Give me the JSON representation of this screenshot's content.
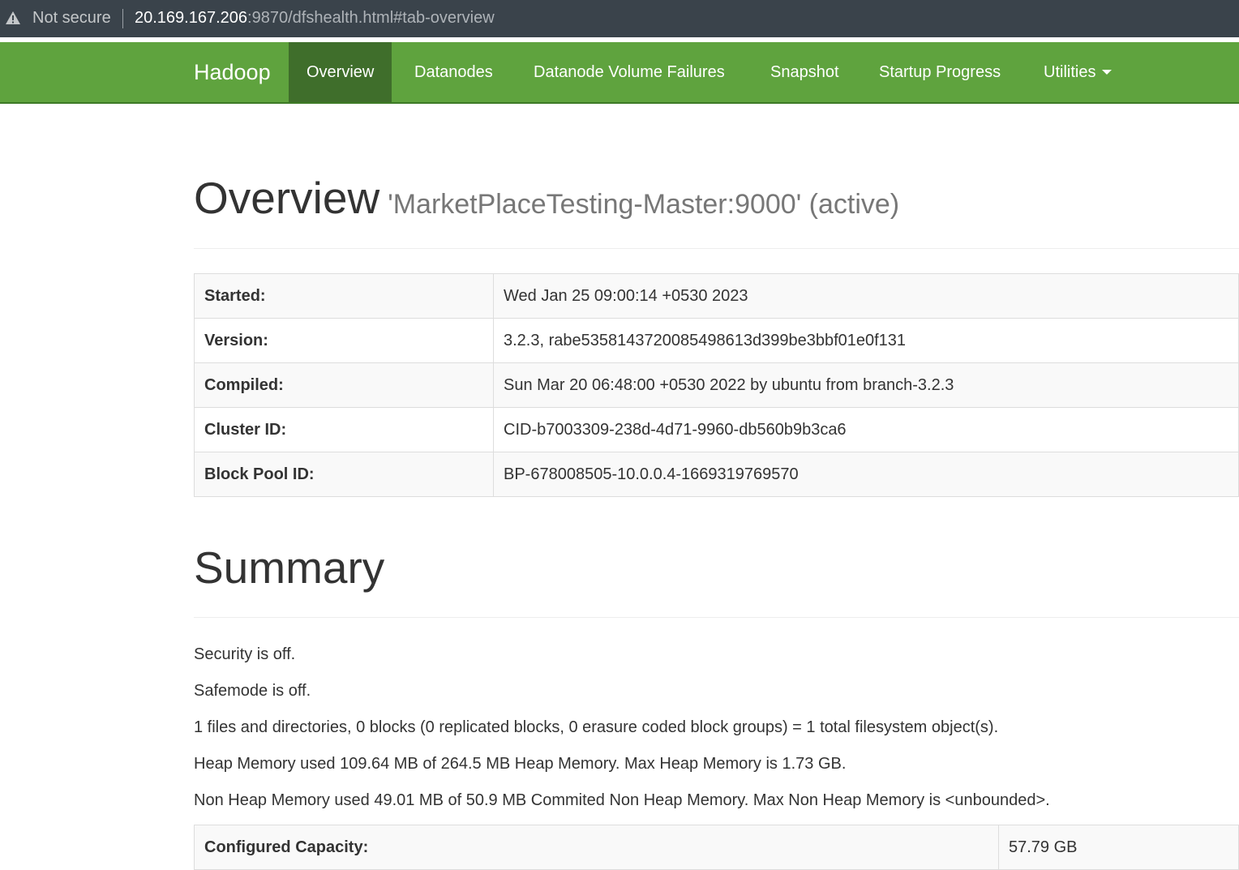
{
  "browser": {
    "security_label": "Not secure",
    "url_host": "20.169.167.206",
    "url_path": ":9870/dfshealth.html#tab-overview"
  },
  "nav": {
    "brand": "Hadoop",
    "items": [
      {
        "label": "Overview",
        "active": true
      },
      {
        "label": "Datanodes"
      },
      {
        "label": "Datanode Volume Failures"
      },
      {
        "label": "Snapshot"
      },
      {
        "label": "Startup Progress"
      },
      {
        "label": "Utilities",
        "dropdown": true
      }
    ]
  },
  "overview": {
    "title": "Overview",
    "subtitle": "'MarketPlaceTesting-Master:9000' (active)",
    "rows": [
      {
        "key": "Started:",
        "value": "Wed Jan 25 09:00:14 +0530 2023"
      },
      {
        "key": "Version:",
        "value": "3.2.3, rabe5358143720085498613d399be3bbf01e0f131"
      },
      {
        "key": "Compiled:",
        "value": "Sun Mar 20 06:48:00 +0530 2022 by ubuntu from branch-3.2.3"
      },
      {
        "key": "Cluster ID:",
        "value": "CID-b7003309-238d-4d71-9960-db560b9b3ca6"
      },
      {
        "key": "Block Pool ID:",
        "value": "BP-678008505-10.0.0.4-1669319769570"
      }
    ]
  },
  "summary": {
    "title": "Summary",
    "lines": [
      "Security is off.",
      "Safemode is off.",
      "1 files and directories, 0 blocks (0 replicated blocks, 0 erasure coded block groups) = 1 total filesystem object(s).",
      "Heap Memory used 109.64 MB of 264.5 MB Heap Memory. Max Heap Memory is 1.73 GB.",
      "Non Heap Memory used 49.01 MB of 50.9 MB Commited Non Heap Memory. Max Non Heap Memory is <unbounded>."
    ],
    "rows": [
      {
        "key": "Configured Capacity:",
        "value": "57.79 GB"
      }
    ]
  },
  "colors": {
    "navbar": "#5fa33e",
    "navbar_active": "#3f6e2b",
    "address_bar": "#3a434b"
  },
  "icons": {
    "security": "warning-triangle-icon",
    "dropdown": "caret-down-icon"
  }
}
